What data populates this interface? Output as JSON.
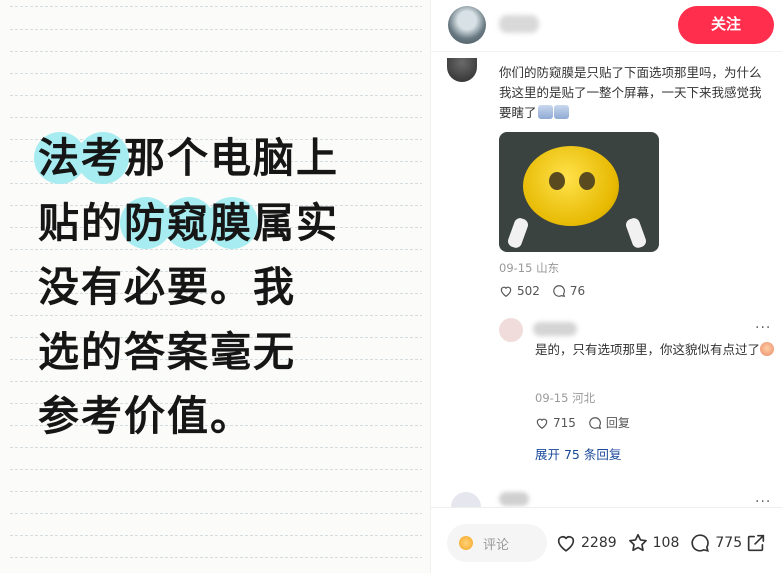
{
  "image_text": {
    "lines": [
      [
        {
          "t": "法考",
          "hl": true
        },
        {
          "t": "那个电脑上"
        }
      ],
      [
        {
          "t": "贴的"
        },
        {
          "t": "防窥膜",
          "hl": true
        },
        {
          "t": "属实"
        }
      ],
      [
        {
          "t": "没有必要。我"
        }
      ],
      [
        {
          "t": "选的答案毫无"
        }
      ],
      [
        {
          "t": "参考价值。"
        }
      ]
    ],
    "highlight_color": "#a6ecf0"
  },
  "header": {
    "follow_label": "关注"
  },
  "comment": {
    "text": "你们的防窥膜是只贴了下面选项那里吗，为什么我这里的是贴了一整个屏幕，一天下来我感觉我要瞎了",
    "date_location": "09-15 山东",
    "likes": "502",
    "replies": "76"
  },
  "reply": {
    "text": "是的，只有选项那里，你这貌似有点过了",
    "date_location": "09-15 河北",
    "likes": "715",
    "reply_label": "回复",
    "more": "···"
  },
  "expand_label": "展开 75 条回复",
  "bottom": {
    "comment_placeholder": "评论",
    "likes": "2289",
    "stars": "108",
    "comments": "775"
  },
  "colors": {
    "follow_bg": "#ff2e4d",
    "link": "#1c4a9c"
  }
}
